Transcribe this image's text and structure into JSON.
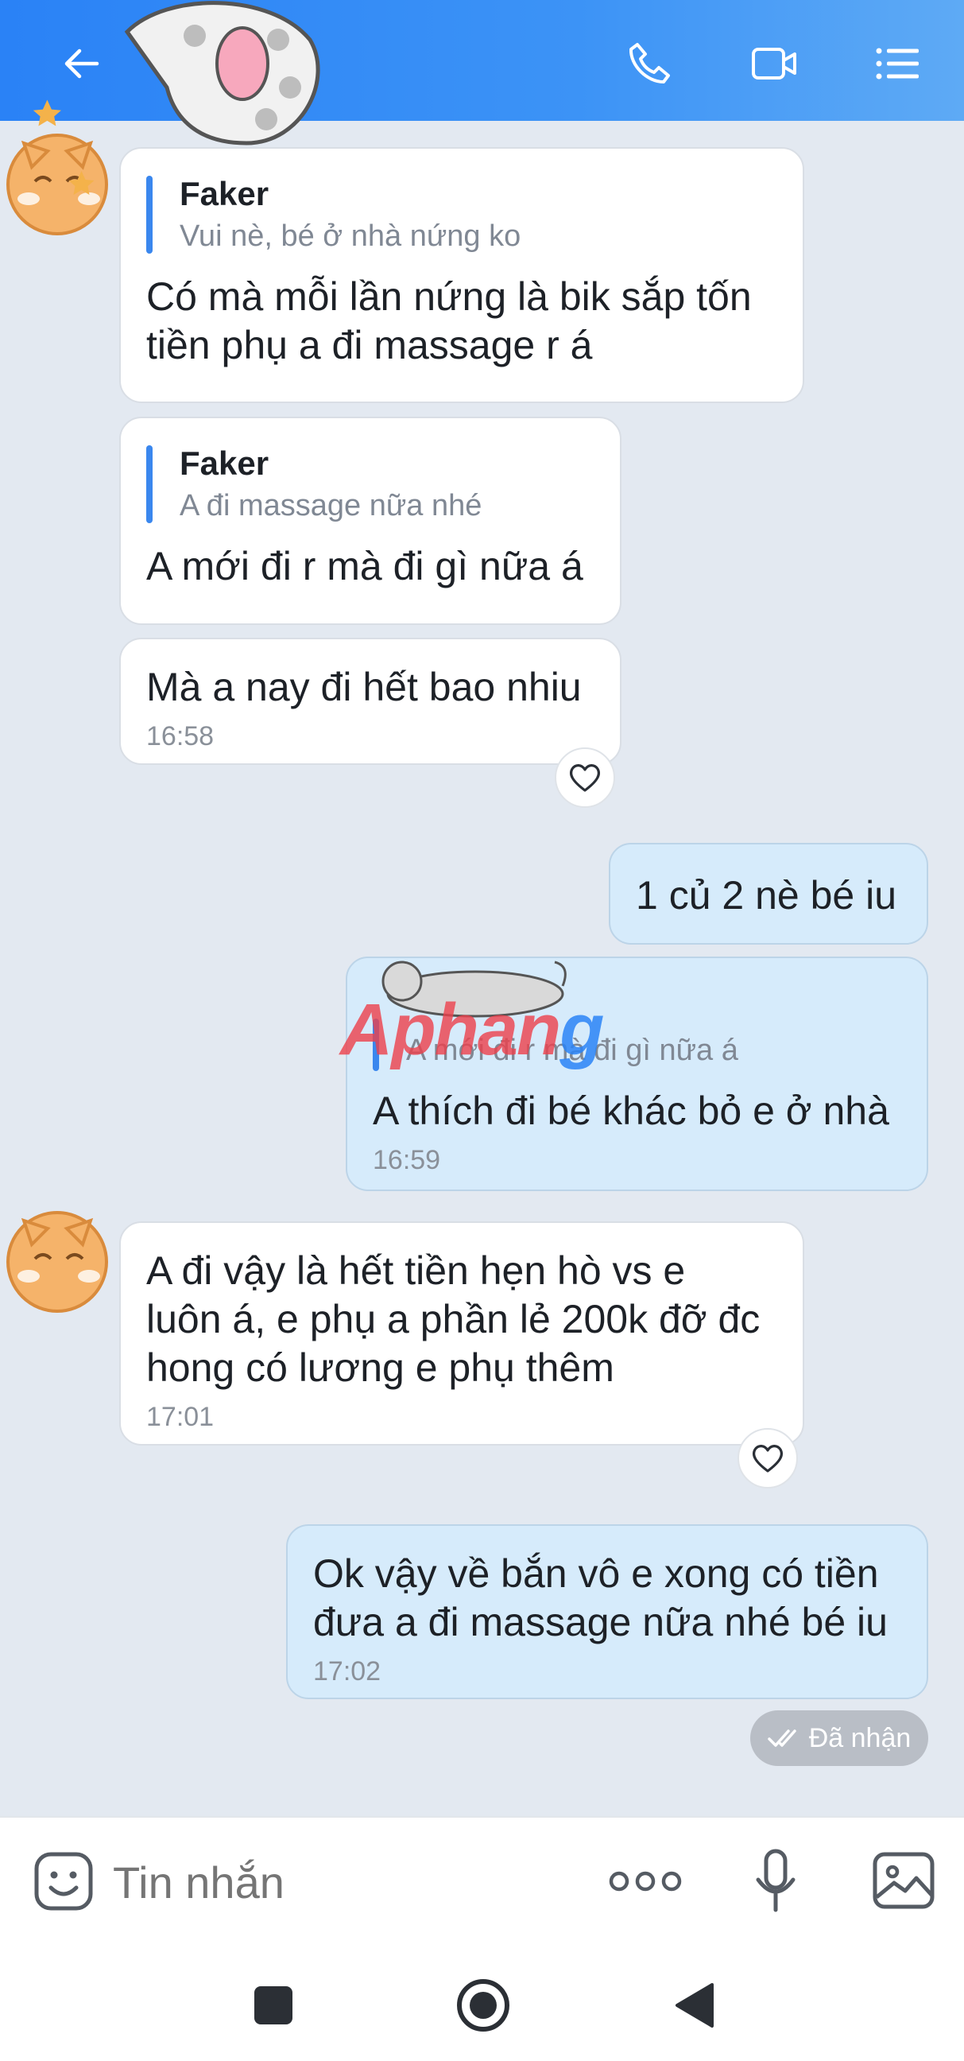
{
  "header": {
    "back_icon": "arrow-left-icon",
    "call_icon": "phone-icon",
    "video_icon": "video-camera-icon",
    "menu_icon": "list-menu-icon",
    "bg_color": "#2a82f6"
  },
  "messages": [
    {
      "side": "received",
      "quote": {
        "name": "Faker",
        "text": "Vui nè, bé ở nhà nứng ko"
      },
      "text": "Có mà mỗi lần nứng là bik sắp tốn\ntiền phụ a đi massage r á"
    },
    {
      "side": "received",
      "quote": {
        "name": "Faker",
        "text": "A đi massage nữa nhé"
      },
      "text": "A mới đi r mà đi gì nữa á"
    },
    {
      "side": "received",
      "text": "Mà a nay đi hết bao nhiu",
      "time": "16:58"
    },
    {
      "side": "sent",
      "text": "1 củ 2 nè bé iu"
    },
    {
      "side": "sent",
      "quote": {
        "text": "A mới đi r mà đi gì nữa á"
      },
      "text": "A thích đi bé khác bỏ e ở nhà",
      "time": "16:59"
    },
    {
      "side": "received",
      "text": "A đi vậy là hết tiền hẹn hò vs e\nluôn á, e phụ a phần lẻ 200k đỡ đc\nhong có lương e phụ thêm",
      "time": "17:01"
    },
    {
      "side": "sent",
      "text": "Ok vậy về bắn vô e xong có tiền\nđưa a đi massage nữa nhé bé iu",
      "time": "17:02"
    }
  ],
  "status": {
    "received_label": "Đã nhận"
  },
  "watermark": {
    "text_red": "Aphan",
    "text_blue": "g"
  },
  "input": {
    "placeholder": "Tin nhắn",
    "emoji_icon": "sticker-emoji-icon",
    "more_icon": "more-dots-icon",
    "mic_icon": "microphone-icon",
    "image_icon": "image-gallery-icon"
  },
  "nav": {
    "recents_icon": "square-icon",
    "home_icon": "circle-home-icon",
    "back_icon": "triangle-back-icon"
  },
  "colors": {
    "sent_bubble": "#d6ebfb",
    "received_bubble": "#ffffff",
    "background": "#e3e9f1",
    "accent": "#3a87ee"
  }
}
